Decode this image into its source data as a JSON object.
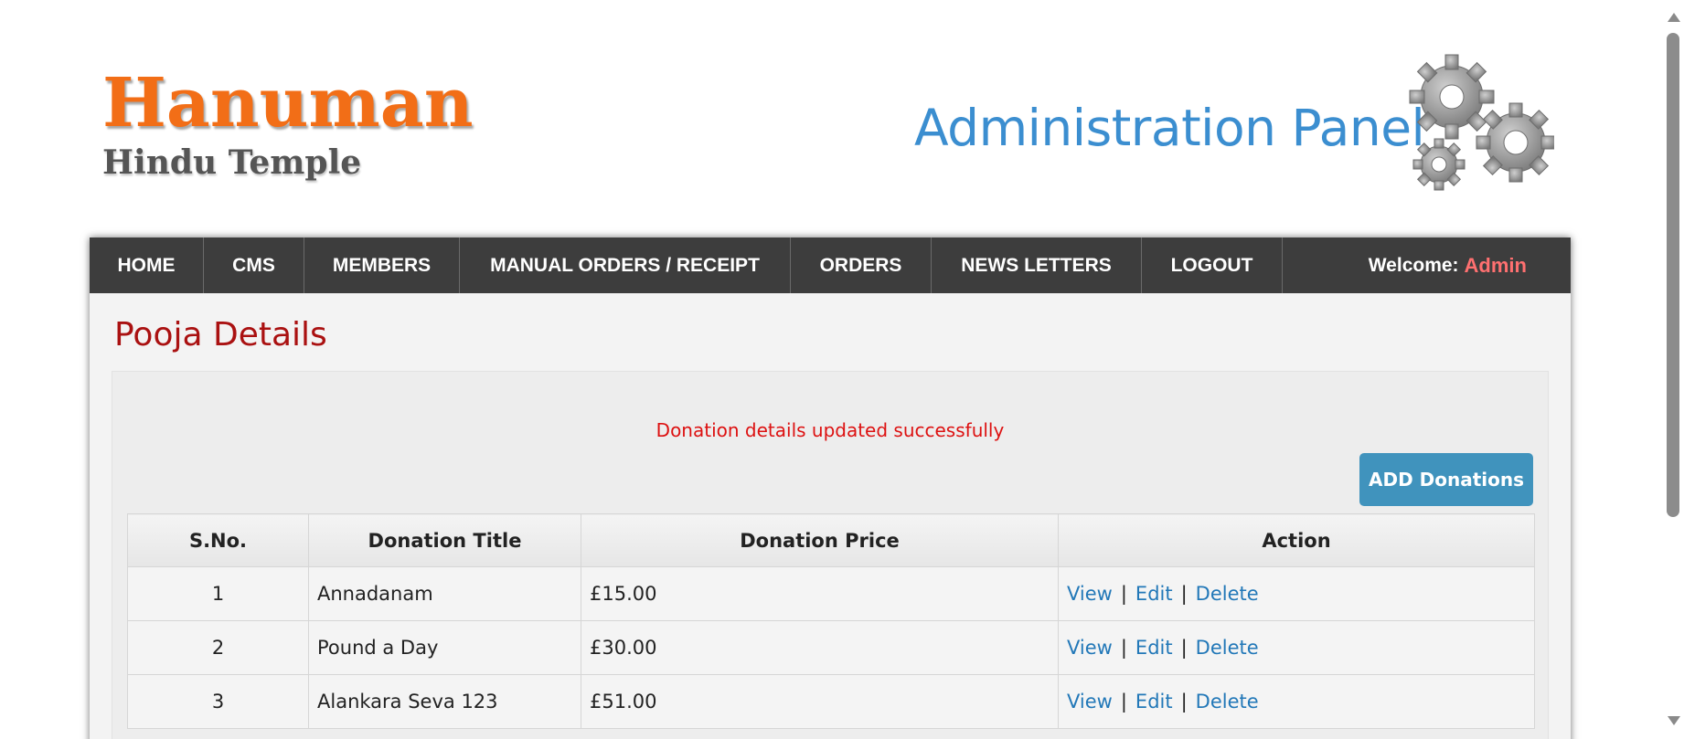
{
  "header": {
    "logo_main": "Hanuman",
    "logo_sub": "Hindu Temple",
    "panel_title": "Administration Panel",
    "gears_icon": "gears-icon"
  },
  "nav": {
    "items": [
      {
        "label": "HOME"
      },
      {
        "label": "CMS"
      },
      {
        "label": "MEMBERS"
      },
      {
        "label": "MANUAL ORDERS / RECEIPT"
      },
      {
        "label": "ORDERS"
      },
      {
        "label": "NEWS LETTERS"
      },
      {
        "label": "LOGOUT"
      }
    ],
    "welcome_label": "Welcome:",
    "welcome_user": "Admin",
    "colors": {
      "bar": "#3d3d3d",
      "user": "#ff7070"
    }
  },
  "main": {
    "title": "Pooja Details",
    "message": "Donation details updated successfully",
    "add_button": "ADD Donations",
    "table": {
      "headers": [
        "S.No.",
        "Donation Title",
        "Donation Price",
        "Action"
      ],
      "rows": [
        {
          "sno": "1",
          "title": "Annadanam",
          "price": "£15.00"
        },
        {
          "sno": "2",
          "title": "Pound a Day",
          "price": "£30.00"
        },
        {
          "sno": "3",
          "title": "Alankara Seva 123",
          "price": "£51.00"
        }
      ],
      "actions": {
        "view": "View",
        "edit": "Edit",
        "delete": "Delete",
        "separator": "|"
      }
    }
  },
  "colors": {
    "accent": "#4093bd",
    "title": "#aa1111",
    "message": "#dd1111",
    "link": "#2278b8",
    "logo": "#f26e17"
  }
}
